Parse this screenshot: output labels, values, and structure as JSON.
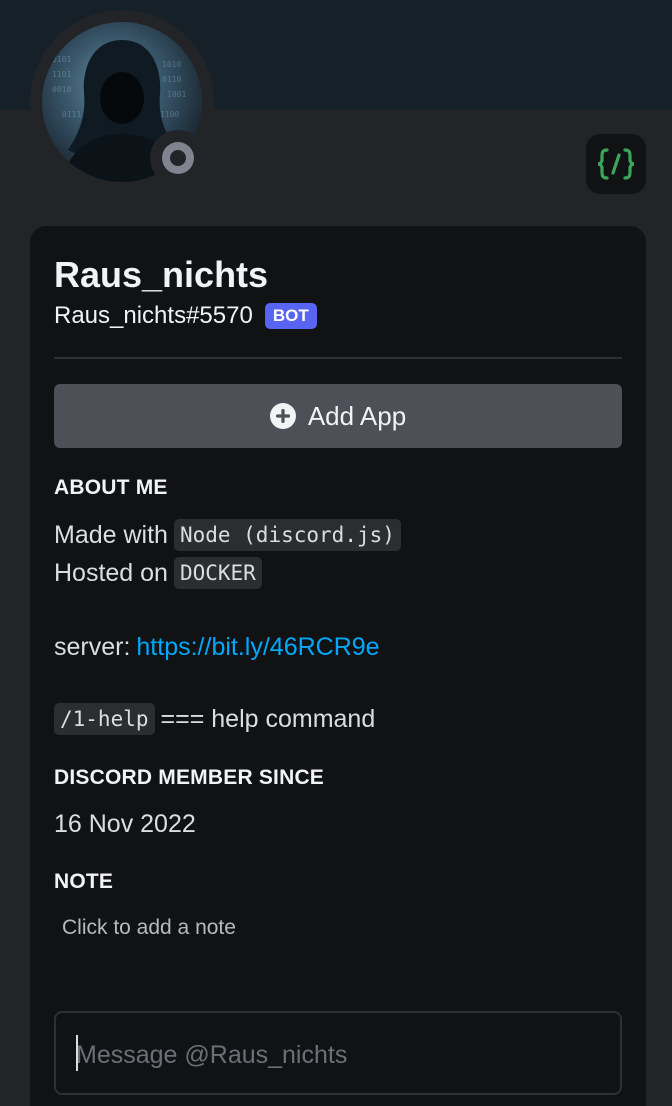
{
  "profile": {
    "display_name": "Raus_nichts",
    "username": "Raus_nichts#5570",
    "bot_tag": "BOT",
    "status": "offline",
    "app_badge_icon": "slash-commands-icon"
  },
  "actions": {
    "add_app_label": "Add App",
    "add_app_icon": "plus-circle-icon"
  },
  "about": {
    "heading": "ABOUT ME",
    "line1_text": "Made with",
    "line1_code": "Node (discord.js)",
    "line2_text": "Hosted on",
    "line2_code": "DOCKER",
    "server_label": "server:",
    "server_link": "https://bit.ly/46RCR9e",
    "help_code": "/1-help",
    "help_text": "=== help command"
  },
  "member_since": {
    "heading": "DISCORD MEMBER SINCE",
    "date": "16 Nov 2022"
  },
  "note": {
    "heading": "NOTE",
    "placeholder": "Click to add a note"
  },
  "message": {
    "placeholder": "Message @Raus_nichts",
    "value": ""
  },
  "colors": {
    "background": "#232428",
    "card": "#111214",
    "banner": "#152029",
    "blurple": "#5865f2",
    "link": "#00a8fc",
    "badge_green": "#3ba55c"
  }
}
